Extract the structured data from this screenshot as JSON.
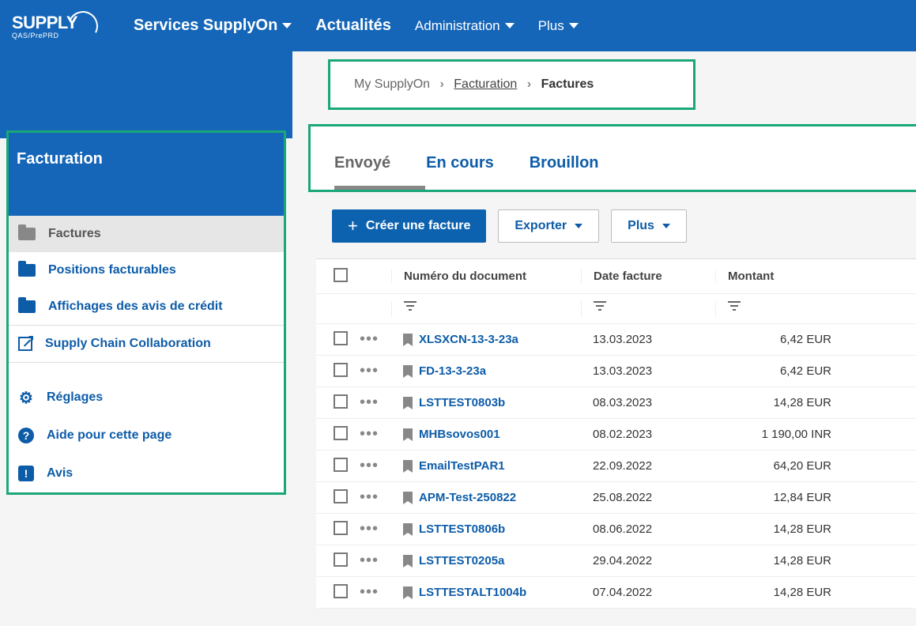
{
  "header": {
    "logo_main": "SUPPLY",
    "logo_sub": "QAS/PrePRD",
    "nav": [
      "Services SupplyOn",
      "Actualités",
      "Administration",
      "Plus"
    ]
  },
  "sidebar": {
    "title": "Facturation",
    "items_main": [
      {
        "label": "Factures",
        "active": true
      },
      {
        "label": "Positions facturables",
        "active": false
      },
      {
        "label": "Affichages des avis de crédit",
        "active": false
      }
    ],
    "item_ext": "Supply Chain Collaboration",
    "items_util": [
      "Réglages",
      "Aide pour cette page",
      "Avis"
    ]
  },
  "breadcrumb": {
    "a": "My SupplyOn",
    "b": "Facturation",
    "c": "Factures"
  },
  "tabs": [
    "Envoyé",
    "En cours",
    "Brouillon"
  ],
  "toolbar": {
    "create": "Créer une facture",
    "export": "Exporter",
    "more": "Plus"
  },
  "table": {
    "headers": {
      "doc": "Numéro du document",
      "date": "Date facture",
      "amount": "Montant"
    },
    "rows": [
      {
        "doc": "XLSXCN-13-3-23a",
        "date": "13.03.2023",
        "amount": "6,42 EUR"
      },
      {
        "doc": "FD-13-3-23a",
        "date": "13.03.2023",
        "amount": "6,42 EUR"
      },
      {
        "doc": "LSTTEST0803b",
        "date": "08.03.2023",
        "amount": "14,28 EUR"
      },
      {
        "doc": "MHBsovos001",
        "date": "08.02.2023",
        "amount": "1 190,00 INR"
      },
      {
        "doc": "EmailTestPAR1",
        "date": "22.09.2022",
        "amount": "64,20 EUR"
      },
      {
        "doc": "APM-Test-250822",
        "date": "25.08.2022",
        "amount": "12,84 EUR"
      },
      {
        "doc": "LSTTEST0806b",
        "date": "08.06.2022",
        "amount": "14,28 EUR"
      },
      {
        "doc": "LSTTEST0205a",
        "date": "29.04.2022",
        "amount": "14,28 EUR"
      },
      {
        "doc": "LSTTESTALT1004b",
        "date": "07.04.2022",
        "amount": "14,28 EUR"
      }
    ]
  }
}
